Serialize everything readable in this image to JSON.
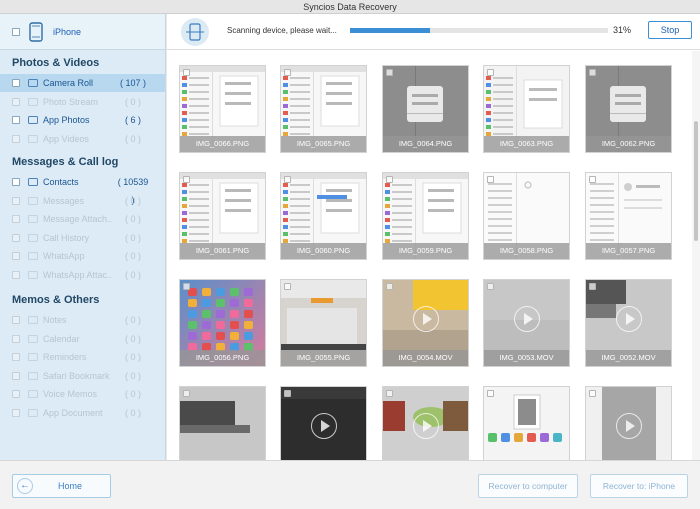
{
  "window": {
    "title": "Syncios Data Recovery"
  },
  "device": {
    "label": "iPhone"
  },
  "sidebar": {
    "sections": [
      {
        "title": "Photos & Videos",
        "items": [
          {
            "label": "Camera Roll",
            "count": "( 107 )",
            "enabled": true,
            "active": true
          },
          {
            "label": "Photo Stream",
            "count": "( 0 )",
            "enabled": false
          },
          {
            "label": "App Photos",
            "count": "( 6 )",
            "enabled": true
          },
          {
            "label": "App Videos",
            "count": "( 0 )",
            "enabled": false
          }
        ]
      },
      {
        "title": "Messages & Call log",
        "items": [
          {
            "label": "Contacts",
            "count": "( 10539 )",
            "enabled": true
          },
          {
            "label": "Messages",
            "count": "( 0 )",
            "enabled": false
          },
          {
            "label": "Message Attach...",
            "count": "( 0 )",
            "enabled": false
          },
          {
            "label": "Call History",
            "count": "( 0 )",
            "enabled": false
          },
          {
            "label": "WhatsApp",
            "count": "( 0 )",
            "enabled": false
          },
          {
            "label": "WhatsApp Attac...",
            "count": "( 0 )",
            "enabled": false
          }
        ]
      },
      {
        "title": "Memos & Others",
        "items": [
          {
            "label": "Notes",
            "count": "( 0 )",
            "enabled": false
          },
          {
            "label": "Calendar",
            "count": "( 0 )",
            "enabled": false
          },
          {
            "label": "Reminders",
            "count": "( 0 )",
            "enabled": false
          },
          {
            "label": "Safari Bookmark",
            "count": "( 0 )",
            "enabled": false
          },
          {
            "label": "Voice Memos",
            "count": "( 0 )",
            "enabled": false
          },
          {
            "label": "App Document",
            "count": "( 0 )",
            "enabled": false
          }
        ]
      }
    ]
  },
  "scan": {
    "status_text": "Scanning device, please wait...",
    "progress": 0.31,
    "percent_label": "31%",
    "stop_label": "Stop"
  },
  "grid": {
    "tiles": [
      {
        "name": "IMG_0066.PNG",
        "kind": "screenshot-settings"
      },
      {
        "name": "IMG_0065.PNG",
        "kind": "screenshot-settings"
      },
      {
        "name": "IMG_0064.PNG",
        "kind": "screenshot-dialog"
      },
      {
        "name": "IMG_0063.PNG",
        "kind": "screenshot-dialog-light"
      },
      {
        "name": "IMG_0062.PNG",
        "kind": "screenshot-dialog"
      },
      {
        "name": "IMG_0061.PNG",
        "kind": "screenshot-settings"
      },
      {
        "name": "IMG_0060.PNG",
        "kind": "screenshot-settings-blue"
      },
      {
        "name": "IMG_0059.PNG",
        "kind": "screenshot-settings"
      },
      {
        "name": "IMG_0058.PNG",
        "kind": "screenshot-contacts"
      },
      {
        "name": "IMG_0057.PNG",
        "kind": "screenshot-contact-card"
      },
      {
        "name": "IMG_0056.PNG",
        "kind": "ipad-home"
      },
      {
        "name": "IMG_0055.PNG",
        "kind": "photo-desk"
      },
      {
        "name": "IMG_0054.MOV",
        "kind": "video-yellow"
      },
      {
        "name": "IMG_0053.MOV",
        "kind": "video-grey"
      },
      {
        "name": "IMG_0052.MOV",
        "kind": "video-keyboard"
      },
      {
        "name": "",
        "kind": "photo-keyboard"
      },
      {
        "name": "",
        "kind": "video-dark"
      },
      {
        "name": "",
        "kind": "video-green"
      },
      {
        "name": "",
        "kind": "screenshot-share"
      },
      {
        "name": "",
        "kind": "video-grey-tall"
      }
    ]
  },
  "footer": {
    "home_label": "Home",
    "recover_computer_label": "Recover to computer",
    "recover_iphone_label": "Recover to: iPhone"
  }
}
